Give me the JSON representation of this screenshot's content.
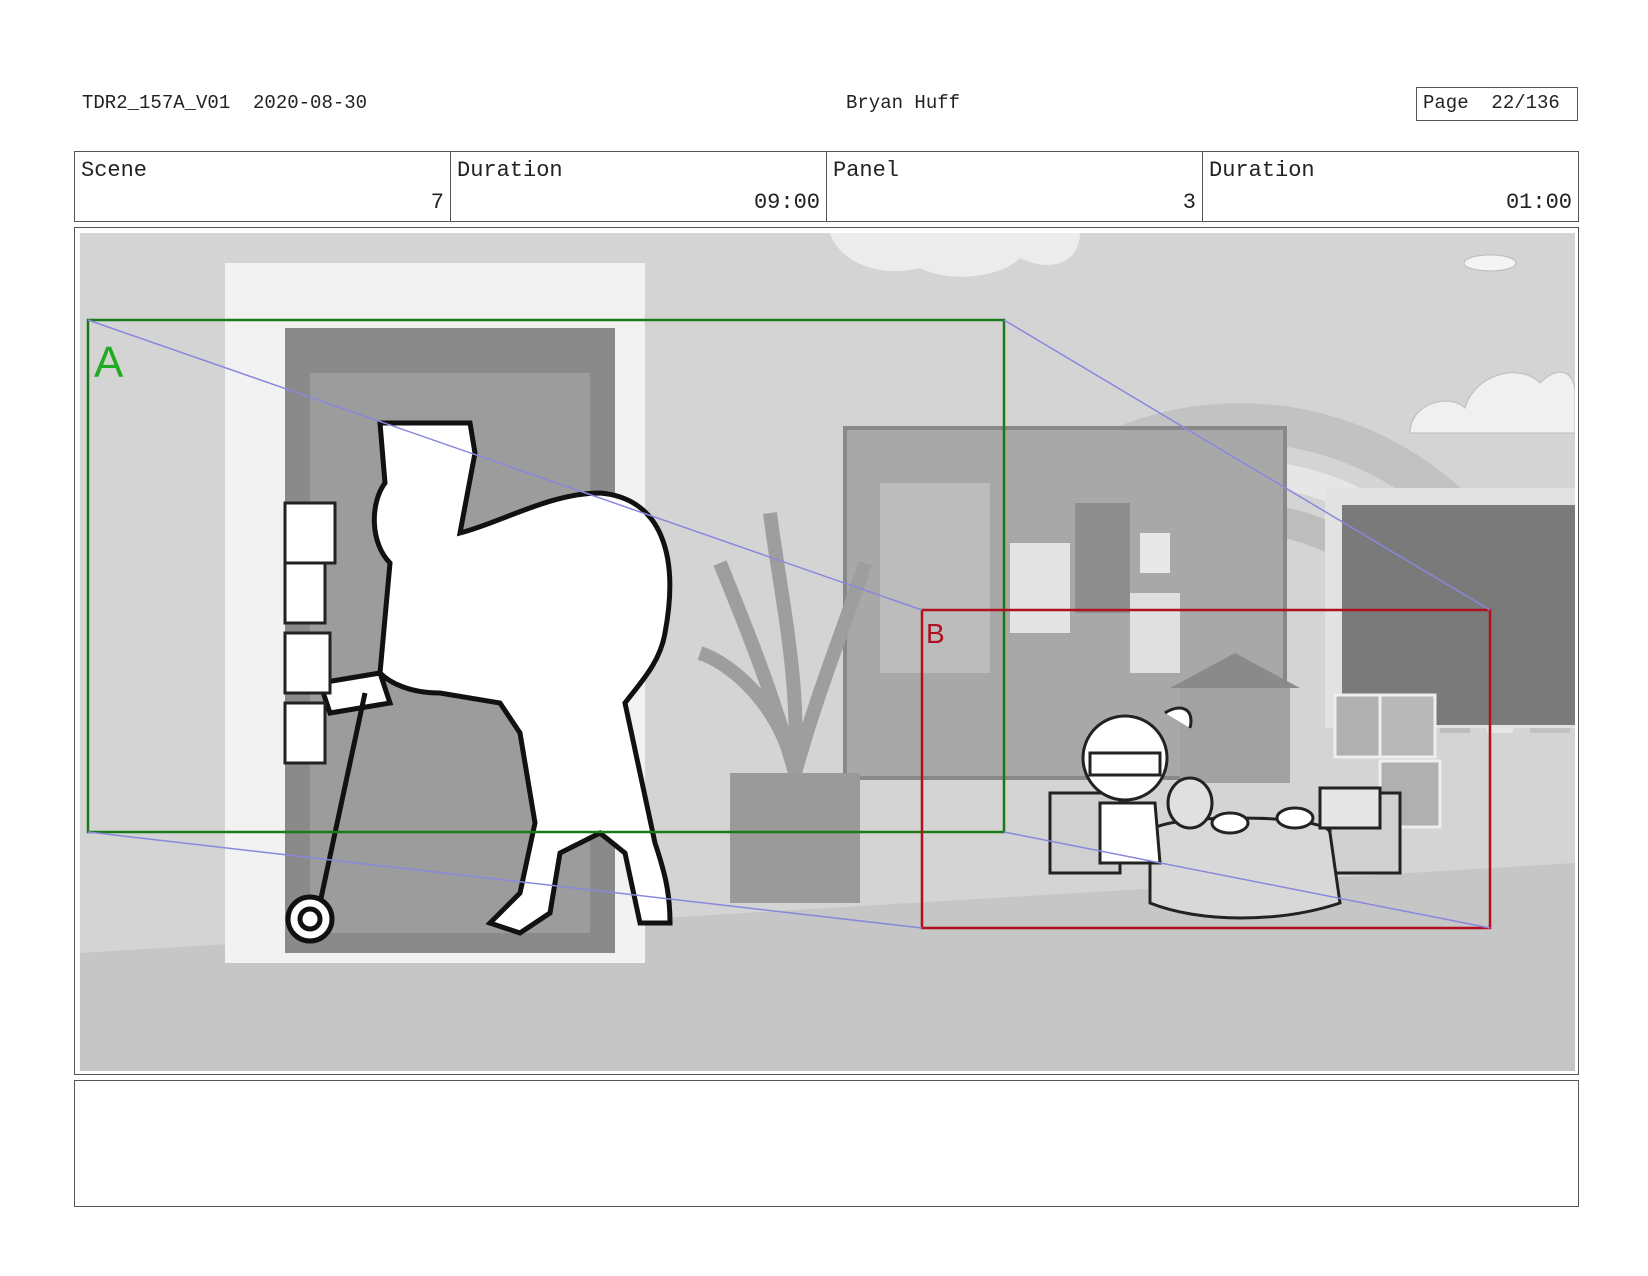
{
  "header": {
    "doc_id": "TDR2_157A_V01  2020-08-30",
    "author": "Bryan Huff",
    "page": "Page  22/136"
  },
  "info": {
    "scene_label": "Scene",
    "scene_value": "7",
    "scene_duration_label": "Duration",
    "scene_duration_value": "09:00",
    "panel_label": "Panel",
    "panel_value": "3",
    "panel_duration_label": "Duration",
    "panel_duration_value": "01:00"
  },
  "panel": {
    "frame_a_label": "A",
    "frame_b_label": "B",
    "frame_a_color": "#1a7a1a",
    "frame_b_color": "#b01020",
    "arrow_color": "#8888dd"
  },
  "notes": ""
}
